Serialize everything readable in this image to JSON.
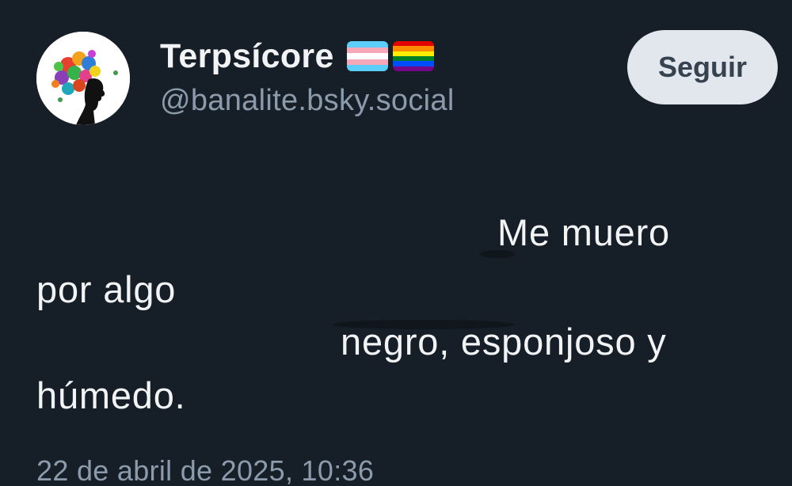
{
  "author": {
    "display_name": "Terpsícore",
    "flags": [
      "transgender-flag",
      "rainbow-flag"
    ],
    "handle": "@banalite.bsky.social"
  },
  "actions": {
    "follow_label": "Seguir"
  },
  "post": {
    "lines": [
      "Me muero",
      "por algo",
      "negro, esponjoso y",
      "húmedo."
    ],
    "timestamp": "22 de abril de 2025, 10:36"
  },
  "colors": {
    "background": "#161e27",
    "text": "#f1f3f5",
    "muted": "#8c9bab",
    "button_bg": "#e2e7ee",
    "button_text": "#36424f"
  }
}
